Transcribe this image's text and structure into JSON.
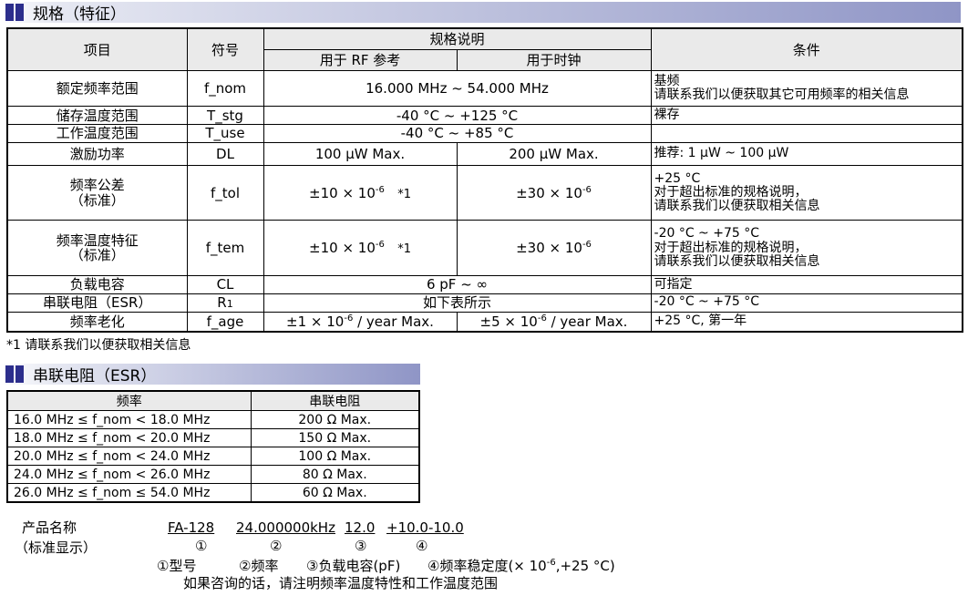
{
  "section1": {
    "title": "规格（特征）"
  },
  "spec_table": {
    "headers": {
      "item": "项目",
      "symbol": "符号",
      "spec": "规格说明",
      "rf": "用于 RF 参考",
      "clock": "用于时钟",
      "condition": "条件"
    },
    "rows": {
      "nominal_freq": {
        "item": "额定频率范围",
        "symbol": "f_nom",
        "value": "16.000 MHz ~ 54.000 MHz",
        "cond1": "基频",
        "cond2": "请联系我们以便获取其它可用频率的相关信息"
      },
      "storage_temp": {
        "item": "储存温度范围",
        "symbol": "T_stg",
        "value": "-40 °C ~ +125 °C",
        "cond": "裸存"
      },
      "operating_temp": {
        "item": "工作温度范围",
        "symbol": "T_use",
        "value": "-40 °C ~ +85 °C",
        "cond": ""
      },
      "drive_level": {
        "item": "激励功率",
        "symbol": "DL",
        "rf": "100 µW Max.",
        "clock": "200 µW Max.",
        "cond": "推荐: 1 µW ~ 100 µW"
      },
      "freq_tol": {
        "item1": "频率公差",
        "item2": "（标准）",
        "symbol": "f_tol",
        "rf_base": "±10 × 10",
        "rf_exp": "-6",
        "rf_note": "*1",
        "clock_base": "±30 × 10",
        "clock_exp": "-6",
        "cond1": "+25 °C",
        "cond2": "对于超出标准的规格说明，",
        "cond3": "请联系我们以便获取相关信息"
      },
      "freq_temp": {
        "item1": "频率温度特征",
        "item2": "（标准）",
        "symbol": "f_tem",
        "rf_base": "±10 × 10",
        "rf_exp": "-6",
        "rf_note": "*1",
        "clock_base": "±30 × 10",
        "clock_exp": "-6",
        "cond1": "-20 °C ~ +75 °C",
        "cond2": "对于超出标准的规格说明，",
        "cond3": "请联系我们以便获取相关信息"
      },
      "load_cap": {
        "item": "负载电容",
        "symbol": "CL",
        "value": "6 pF ~ ∞",
        "cond": "可指定"
      },
      "esr": {
        "item": "串联电阻（ESR）",
        "symbol_main": "R",
        "symbol_sub": "1",
        "value": "如下表所示",
        "cond": "-20 °C ~ +75 °C"
      },
      "aging": {
        "item": "频率老化",
        "symbol": "f_age",
        "rf_base": "±1 × 10",
        "rf_exp": "-6",
        "rf_tail": " / year Max.",
        "clock_base": "±5 × 10",
        "clock_exp": "-6",
        "clock_tail": " / year Max.",
        "cond": "+25 °C, 第一年"
      }
    }
  },
  "footnote": "*1 请联系我们以便获取相关信息",
  "section2": {
    "title": "串联电阻（ESR）"
  },
  "esr_table": {
    "headers": {
      "freq": "频率",
      "resistance": "串联电阻"
    },
    "rows": [
      {
        "freq": "16.0 MHz ≤ f_nom < 18.0 MHz",
        "res": "200 Ω Max."
      },
      {
        "freq": "18.0 MHz ≤ f_nom < 20.0 MHz",
        "res": "150 Ω Max."
      },
      {
        "freq": "20.0 MHz ≤ f_nom < 24.0 MHz",
        "res": "100 Ω Max."
      },
      {
        "freq": "24.0 MHz ≤ f_nom < 26.0 MHz",
        "res": "80 Ω Max."
      },
      {
        "freq": "26.0 MHz ≤ f_nom ≤ 54.0 MHz",
        "res": "60 Ω Max."
      }
    ]
  },
  "product": {
    "label1": "产品名称",
    "label2": "（标准显示）",
    "codes": [
      "FA-128",
      "24.000000kHz",
      "12.0",
      "+10.0-10.0"
    ],
    "numbers": [
      "①",
      "②",
      "③",
      "④"
    ],
    "legend": {
      "p1": "①型号",
      "p2": "②频率",
      "p3": "③负载电容(pF)",
      "p4_pre": "④频率稳定度(× 10",
      "p4_exp": "-6",
      "p4_post": ",+25 °C)"
    },
    "note": "如果咨询的话，请注明频率温度特性和工作温度范围"
  }
}
